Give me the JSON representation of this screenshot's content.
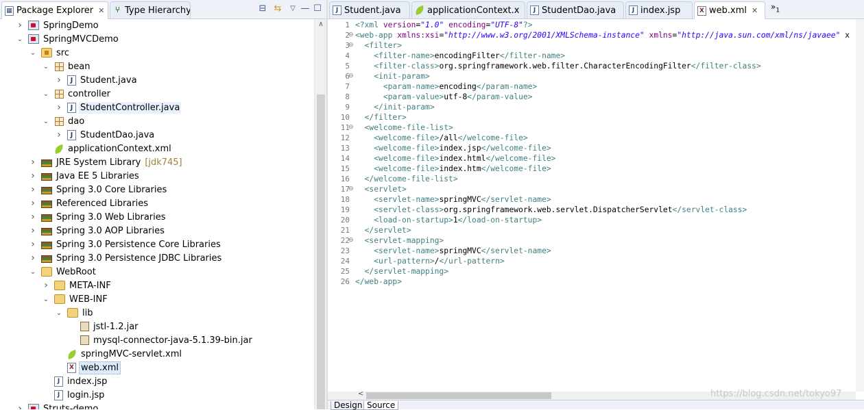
{
  "left_panel": {
    "tabs": [
      {
        "label": "Package Explorer",
        "icon": "package-explorer-icon",
        "active": true
      },
      {
        "label": "Type Hierarchy",
        "icon": "type-hierarchy-icon",
        "active": false
      }
    ],
    "tree": [
      {
        "label": "SpringDemo",
        "icon": "project",
        "depth": 1,
        "expand": "collapsed"
      },
      {
        "label": "SpringMVCDemo",
        "icon": "project",
        "depth": 1,
        "expand": "expanded"
      },
      {
        "label": "src",
        "icon": "srcfolder",
        "depth": 2,
        "expand": "expanded"
      },
      {
        "label": "bean",
        "icon": "package",
        "depth": 3,
        "expand": "expanded"
      },
      {
        "label": "Student.java",
        "icon": "java",
        "depth": 4,
        "expand": "collapsed"
      },
      {
        "label": "controller",
        "icon": "package",
        "depth": 3,
        "expand": "expanded"
      },
      {
        "label": "StudentController.java",
        "icon": "java",
        "depth": 4,
        "expand": "collapsed",
        "highlight": true
      },
      {
        "label": "dao",
        "icon": "package",
        "depth": 3,
        "expand": "expanded"
      },
      {
        "label": "StudentDao.java",
        "icon": "java",
        "depth": 4,
        "expand": "collapsed"
      },
      {
        "label": "applicationContext.xml",
        "icon": "leafic",
        "depth": 3,
        "expand": "none"
      },
      {
        "label": "JRE System Library",
        "decoration": "[jdk745]",
        "icon": "library",
        "depth": 2,
        "expand": "collapsed"
      },
      {
        "label": "Java EE 5 Libraries",
        "icon": "library",
        "depth": 2,
        "expand": "collapsed"
      },
      {
        "label": "Spring 3.0 Core Libraries",
        "icon": "library",
        "depth": 2,
        "expand": "collapsed"
      },
      {
        "label": "Referenced Libraries",
        "icon": "library",
        "depth": 2,
        "expand": "collapsed"
      },
      {
        "label": "Spring 3.0 Web Libraries",
        "icon": "library",
        "depth": 2,
        "expand": "collapsed"
      },
      {
        "label": "Spring 3.0 AOP Libraries",
        "icon": "library",
        "depth": 2,
        "expand": "collapsed"
      },
      {
        "label": "Spring 3.0 Persistence Core Libraries",
        "icon": "library",
        "depth": 2,
        "expand": "collapsed"
      },
      {
        "label": "Spring 3.0 Persistence JDBC Libraries",
        "icon": "library",
        "depth": 2,
        "expand": "collapsed"
      },
      {
        "label": "WebRoot",
        "icon": "folder",
        "depth": 2,
        "expand": "expanded"
      },
      {
        "label": "META-INF",
        "icon": "folder",
        "depth": 3,
        "expand": "collapsed"
      },
      {
        "label": "WEB-INF",
        "icon": "folder",
        "depth": 3,
        "expand": "expanded"
      },
      {
        "label": "lib",
        "icon": "folder",
        "depth": 4,
        "expand": "expanded"
      },
      {
        "label": "jstl-1.2.jar",
        "icon": "jar",
        "depth": 5,
        "expand": "none"
      },
      {
        "label": "mysql-connector-java-5.1.39-bin.jar",
        "icon": "jar",
        "depth": 5,
        "expand": "none"
      },
      {
        "label": "springMVC-servlet.xml",
        "icon": "leafic",
        "depth": 4,
        "expand": "none"
      },
      {
        "label": "web.xml",
        "icon": "xml",
        "depth": 4,
        "expand": "none",
        "selected": true
      },
      {
        "label": "index.jsp",
        "icon": "jsp",
        "depth": 3,
        "expand": "none"
      },
      {
        "label": "login.jsp",
        "icon": "jsp",
        "depth": 3,
        "expand": "none"
      },
      {
        "label": "Struts-demo",
        "icon": "project",
        "depth": 1,
        "expand": "collapsed"
      }
    ]
  },
  "editor": {
    "tabs": [
      {
        "label": "Student.java",
        "icon": "java-file-icon",
        "active": false
      },
      {
        "label": "applicationContext.x",
        "icon": "spring-config-icon",
        "active": false
      },
      {
        "label": "StudentDao.java",
        "icon": "java-file-icon",
        "active": false
      },
      {
        "label": "index.jsp",
        "icon": "jsp-file-icon",
        "active": false
      },
      {
        "label": "web.xml",
        "icon": "xml-file-icon",
        "active": true
      }
    ],
    "overflow_count": "1",
    "lines": [
      [
        [
          "tg",
          "<?"
        ],
        [
          "tg",
          "xml "
        ],
        [
          "an",
          "version"
        ],
        [
          "tx",
          "="
        ],
        [
          "av",
          "\"1.0\""
        ],
        [
          "tx",
          " "
        ],
        [
          "an",
          "encoding"
        ],
        [
          "tx",
          "="
        ],
        [
          "av",
          "\"UTF-8\""
        ],
        [
          "tg",
          "?>"
        ]
      ],
      [
        [
          "tg",
          "<web-app "
        ],
        [
          "an",
          "xmlns:xsi"
        ],
        [
          "tx",
          "="
        ],
        [
          "av",
          "\"http://www.w3.org/2001/XMLSchema-instance\""
        ],
        [
          "tx",
          " "
        ],
        [
          "an",
          "xmlns"
        ],
        [
          "tx",
          "="
        ],
        [
          "av",
          "\"http://java.sun.com/xml/ns/javaee\""
        ],
        [
          "tx",
          " x"
        ]
      ],
      [
        [
          "tx",
          "  "
        ],
        [
          "tg",
          "<filter>"
        ]
      ],
      [
        [
          "tx",
          "    "
        ],
        [
          "tg",
          "<filter-name>"
        ],
        [
          "tx",
          "encodingFilter"
        ],
        [
          "tg",
          "</filter-name>"
        ]
      ],
      [
        [
          "tx",
          "    "
        ],
        [
          "tg",
          "<filter-class>"
        ],
        [
          "tx",
          "org.springframework.web.filter.CharacterEncodingFilter"
        ],
        [
          "tg",
          "</filter-class>"
        ]
      ],
      [
        [
          "tx",
          "    "
        ],
        [
          "tg",
          "<init-param>"
        ]
      ],
      [
        [
          "tx",
          "      "
        ],
        [
          "tg",
          "<param-name>"
        ],
        [
          "tx",
          "encoding"
        ],
        [
          "tg",
          "</param-name>"
        ]
      ],
      [
        [
          "tx",
          "      "
        ],
        [
          "tg",
          "<param-value>"
        ],
        [
          "tx",
          "utf-8"
        ],
        [
          "tg",
          "</param-value>"
        ]
      ],
      [
        [
          "tx",
          "    "
        ],
        [
          "tg",
          "</init-param>"
        ]
      ],
      [
        [
          "tx",
          "  "
        ],
        [
          "tg",
          "</filter>"
        ]
      ],
      [
        [
          "tx",
          "  "
        ],
        [
          "tg",
          "<welcome-file-list>"
        ]
      ],
      [
        [
          "tx",
          "    "
        ],
        [
          "tg",
          "<welcome-file>"
        ],
        [
          "tx",
          "/all"
        ],
        [
          "tg",
          "</welcome-file>"
        ]
      ],
      [
        [
          "tx",
          "    "
        ],
        [
          "tg",
          "<welcome-file>"
        ],
        [
          "tx",
          "index.jsp"
        ],
        [
          "tg",
          "</welcome-file>"
        ]
      ],
      [
        [
          "tx",
          "    "
        ],
        [
          "tg",
          "<welcome-file>"
        ],
        [
          "tx",
          "index.html"
        ],
        [
          "tg",
          "</welcome-file>"
        ]
      ],
      [
        [
          "tx",
          "    "
        ],
        [
          "tg",
          "<welcome-file>"
        ],
        [
          "tx",
          "index.htm"
        ],
        [
          "tg",
          "</welcome-file>"
        ]
      ],
      [
        [
          "tx",
          "  "
        ],
        [
          "tg",
          "</welcome-file-list>"
        ]
      ],
      [
        [
          "tx",
          "  "
        ],
        [
          "tg",
          "<servlet>"
        ]
      ],
      [
        [
          "tx",
          "    "
        ],
        [
          "tg",
          "<servlet-name>"
        ],
        [
          "tx",
          "springMVC"
        ],
        [
          "tg",
          "</servlet-name>"
        ]
      ],
      [
        [
          "tx",
          "    "
        ],
        [
          "tg",
          "<servlet-class>"
        ],
        [
          "tx",
          "org.springframework.web.servlet.DispatcherServlet"
        ],
        [
          "tg",
          "</servlet-class>"
        ]
      ],
      [
        [
          "tx",
          "    "
        ],
        [
          "tg",
          "<load-on-startup>"
        ],
        [
          "tx",
          "1"
        ],
        [
          "tg",
          "</load-on-startup>"
        ]
      ],
      [
        [
          "tx",
          "  "
        ],
        [
          "tg",
          "</servlet>"
        ]
      ],
      [
        [
          "tx",
          "  "
        ],
        [
          "tg",
          "<servlet-mapping>"
        ]
      ],
      [
        [
          "tx",
          "    "
        ],
        [
          "tg",
          "<servlet-name>"
        ],
        [
          "tx",
          "springMVC"
        ],
        [
          "tg",
          "</servlet-name>"
        ]
      ],
      [
        [
          "tx",
          "    "
        ],
        [
          "tg",
          "<url-pattern>"
        ],
        [
          "tx",
          "/"
        ],
        [
          "tg",
          "</url-pattern>"
        ]
      ],
      [
        [
          "tx",
          "  "
        ],
        [
          "tg",
          "</servlet-mapping>"
        ]
      ],
      [
        [
          "tg",
          "</web-app>"
        ]
      ]
    ],
    "fold_lines": [
      2,
      3,
      6,
      11,
      17,
      22
    ],
    "bottom_tabs": [
      "Design",
      "Source"
    ]
  },
  "watermark": "https://blog.csdn.net/tokyo97",
  "colors": {
    "tag": "#3f7f7f",
    "attr_name": "#7f007f",
    "attr_value": "#2a00ff",
    "selection": "#dcecfc"
  }
}
